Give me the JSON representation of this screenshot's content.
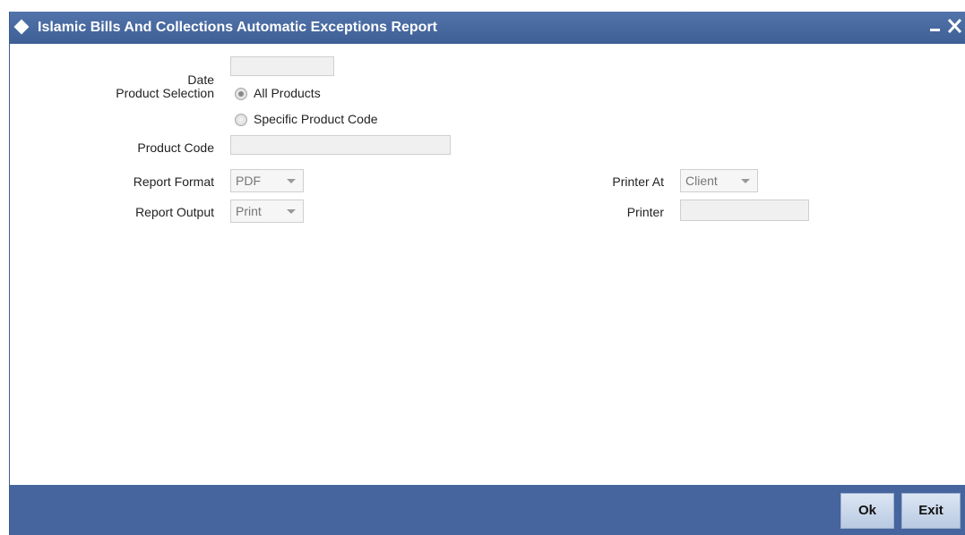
{
  "window": {
    "title": "Islamic Bills And Collections Automatic Exceptions Report",
    "minimize_icon": "minimize-icon",
    "close_icon": "close-icon"
  },
  "form": {
    "date": {
      "label": "Date",
      "value": ""
    },
    "product_selection": {
      "label": "Product Selection",
      "options": [
        {
          "label": "All Products",
          "selected": true
        },
        {
          "label": "Specific Product Code",
          "selected": false
        }
      ]
    },
    "product_code": {
      "label": "Product Code",
      "value": ""
    },
    "report_format": {
      "label": "Report Format",
      "value": "PDF"
    },
    "report_output": {
      "label": "Report Output",
      "value": "Print"
    },
    "printer_at": {
      "label": "Printer At",
      "value": "Client"
    },
    "printer": {
      "label": "Printer",
      "value": ""
    }
  },
  "footer": {
    "ok_label": "Ok",
    "exit_label": "Exit"
  },
  "colors": {
    "titlebar": "#46659e",
    "footer": "#46659e",
    "button": "#c9d7ec"
  }
}
